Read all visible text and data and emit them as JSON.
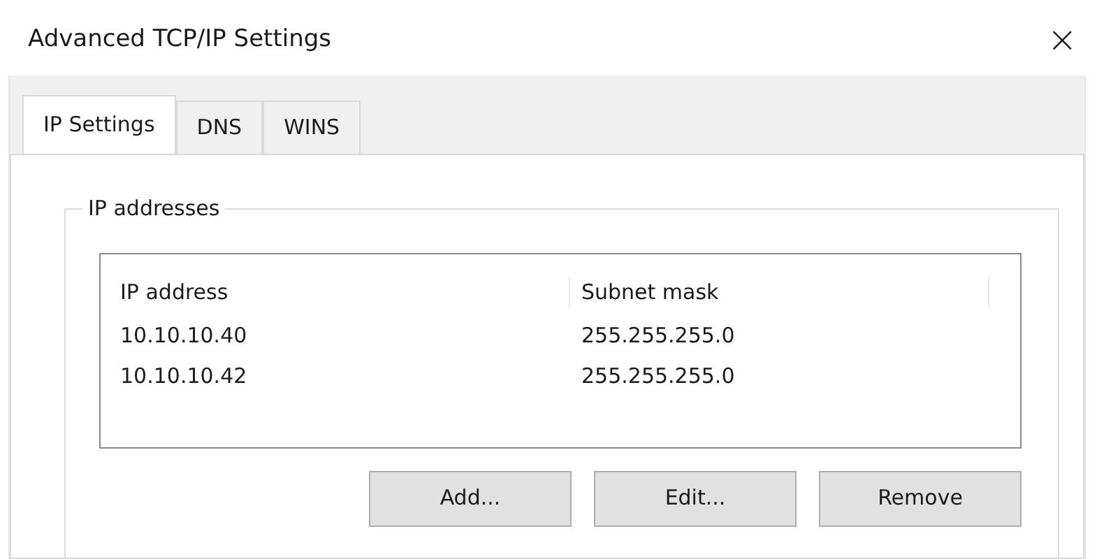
{
  "window": {
    "title": "Advanced TCP/IP Settings",
    "close": "×"
  },
  "tabs": [
    {
      "label": "IP Settings",
      "selected": true
    },
    {
      "label": "DNS",
      "selected": false
    },
    {
      "label": "WINS",
      "selected": false
    }
  ],
  "group": {
    "legend": "IP addresses",
    "table": {
      "columns": [
        "IP address",
        "Subnet mask"
      ],
      "rows": [
        [
          "10.10.10.40",
          "255.255.255.0"
        ],
        [
          "10.10.10.42",
          "255.255.255.0"
        ]
      ]
    },
    "buttons": [
      "Add...",
      "Edit...",
      "Remove"
    ]
  }
}
